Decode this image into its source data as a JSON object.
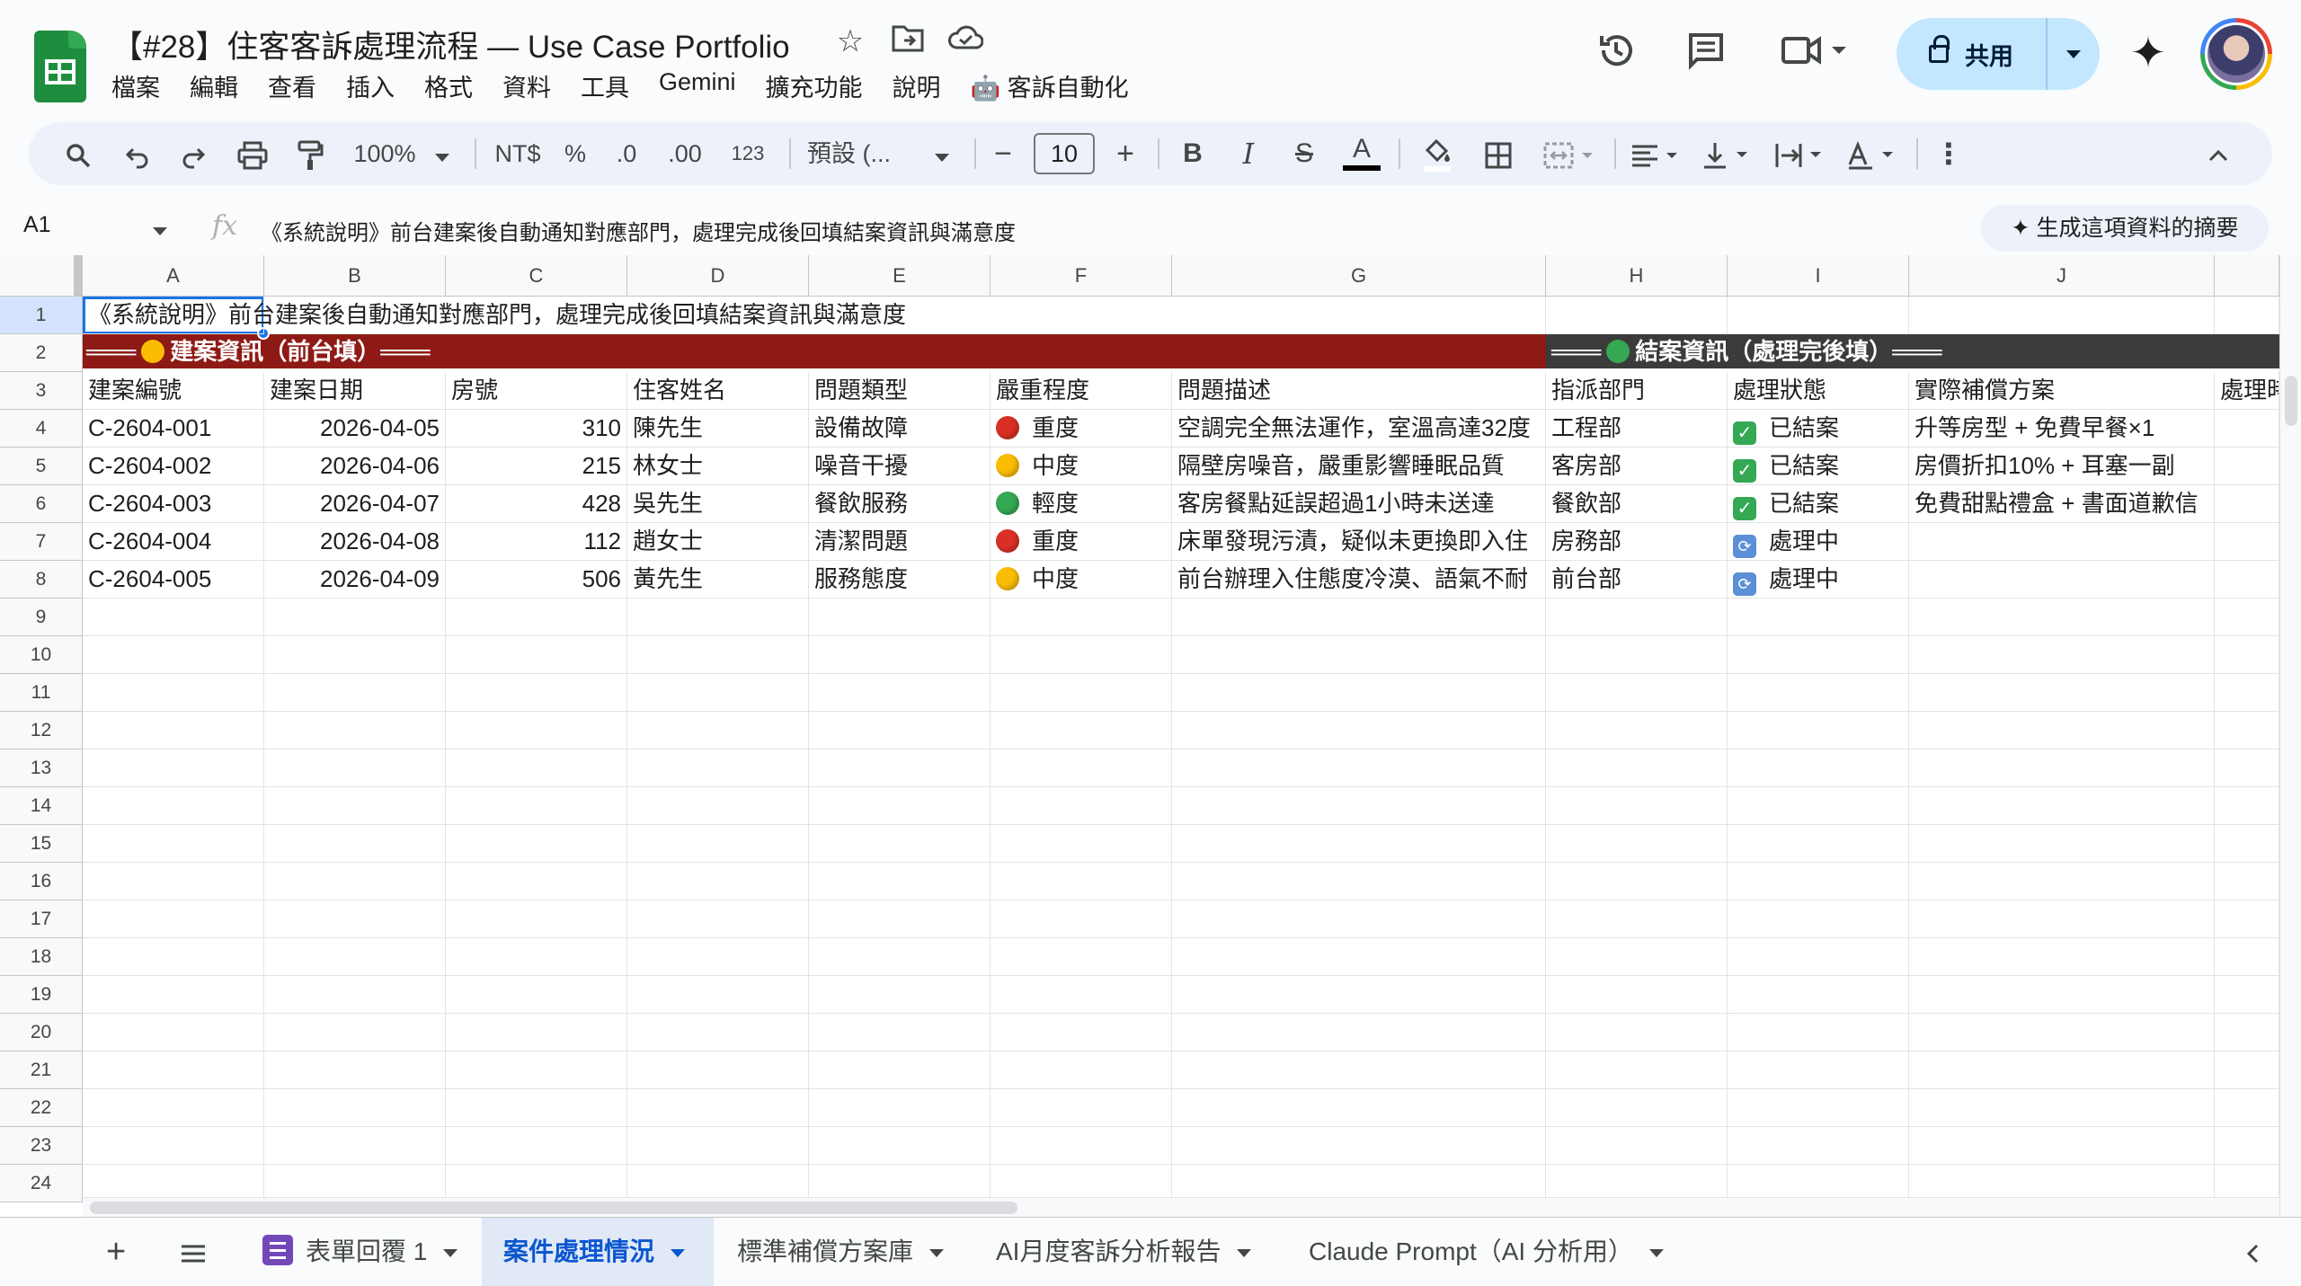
{
  "header": {
    "doc_title": "【#28】住客客訴處理流程 — Use Case Portfolio",
    "menu": [
      "檔案",
      "編輯",
      "查看",
      "插入",
      "格式",
      "資料",
      "工具",
      "Gemini",
      "擴充功能",
      "說明",
      "🤖 客訴自動化"
    ],
    "share_label": "共用"
  },
  "toolbar": {
    "zoom": "100%",
    "currency": "NT$",
    "percent": "%",
    "dec_decrease": ".0",
    "dec_increase": ".00",
    "number_format": "123",
    "font_family": "預設 (...",
    "font_size": "10",
    "minus": "−",
    "plus": "+",
    "bold": "B",
    "italic": "I",
    "strike": "S",
    "text_color": "A"
  },
  "formula_bar": {
    "name_box": "A1",
    "fx": "fx",
    "content": "《系統說明》前台建案後自動通知對應部門，處理完成後回填結案資訊與滿意度",
    "summary_button": "✦ 生成這項資料的摘要"
  },
  "grid": {
    "columns": [
      "A",
      "B",
      "C",
      "D",
      "E",
      "F",
      "G",
      "H",
      "I",
      "J"
    ],
    "row_numbers": [
      "1",
      "2",
      "3",
      "4",
      "5",
      "6",
      "7",
      "8",
      "9",
      "10",
      "11",
      "12",
      "13",
      "14",
      "15",
      "16",
      "17",
      "18",
      "19",
      "20",
      "21",
      "22",
      "23",
      "24"
    ],
    "a1_text": "《系統說明》前台建案後自動通知對應部門，處理完成後回填結案資訊與滿意度",
    "section_left": "═══ 🟡 建案資訊（前台填）═══",
    "section_left_pre": "═══",
    "section_left_label": "建案資訊（前台填）═══",
    "section_right_pre": "═══",
    "section_right_label": "結案資訊（處理完後填）═══",
    "headers": [
      "建案編號",
      "建案日期",
      "房號",
      "住客姓名",
      "問題類型",
      "嚴重程度",
      "問題描述",
      "指派部門",
      "處理狀態",
      "實際補償方案",
      "處理時"
    ],
    "rows": [
      {
        "id": "C-2604-001",
        "date": "2026-04-05",
        "room": "310",
        "guest": "陳先生",
        "type": "設備故障",
        "severity": "重度",
        "severity_color": "#d93025",
        "desc": "空調完全無法運作，室溫高達32度",
        "dept": "工程部",
        "status": "已結案",
        "status_kind": "done",
        "comp": "升等房型 + 免費早餐×1"
      },
      {
        "id": "C-2604-002",
        "date": "2026-04-06",
        "room": "215",
        "guest": "林女士",
        "type": "噪音干擾",
        "severity": "中度",
        "severity_color": "#fbbc04",
        "desc": "隔壁房噪音，嚴重影響睡眠品質",
        "dept": "客房部",
        "status": "已結案",
        "status_kind": "done",
        "comp": "房價折扣10% + 耳塞一副"
      },
      {
        "id": "C-2604-003",
        "date": "2026-04-07",
        "room": "428",
        "guest": "吳先生",
        "type": "餐飲服務",
        "severity": "輕度",
        "severity_color": "#34a853",
        "desc": "客房餐點延誤超過1小時未送達",
        "dept": "餐飲部",
        "status": "已結案",
        "status_kind": "done",
        "comp": "免費甜點禮盒 + 書面道歉信"
      },
      {
        "id": "C-2604-004",
        "date": "2026-04-08",
        "room": "112",
        "guest": "趙女士",
        "type": "清潔問題",
        "severity": "重度",
        "severity_color": "#d93025",
        "desc": "床單發現污漬，疑似未更換即入住",
        "dept": "房務部",
        "status": "處理中",
        "status_kind": "processing",
        "comp": ""
      },
      {
        "id": "C-2604-005",
        "date": "2026-04-09",
        "room": "506",
        "guest": "黃先生",
        "type": "服務態度",
        "severity": "中度",
        "severity_color": "#fbbc04",
        "desc": "前台辦理入住態度冷漠、語氣不耐",
        "dept": "前台部",
        "status": "處理中",
        "status_kind": "processing",
        "comp": ""
      }
    ]
  },
  "sheet_tabs": [
    "表單回覆 1",
    "案件處理情況",
    "標準補償方案庫",
    "AI月度客訴分析報告",
    "Claude Prompt（AI 分析用）"
  ],
  "active_tab": "案件處理情況"
}
